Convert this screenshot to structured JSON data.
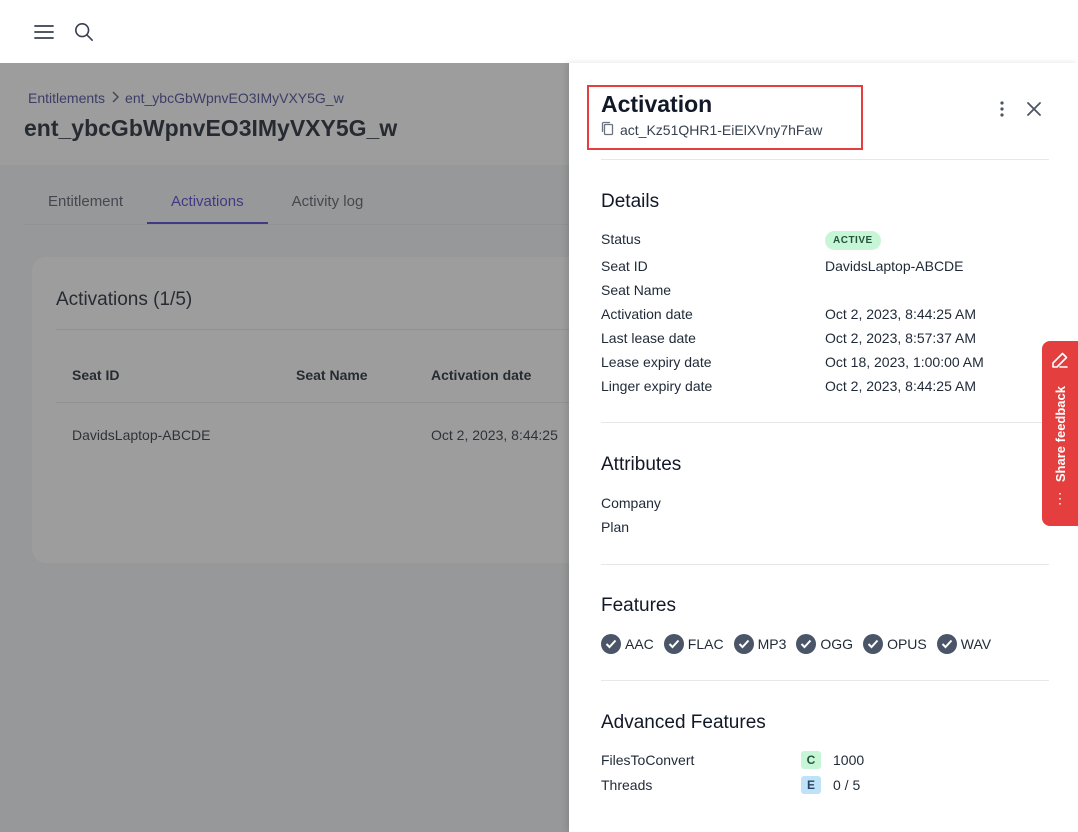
{
  "topbar": {
    "menu_icon": "hamburger-menu-icon",
    "search_icon": "search-icon"
  },
  "page": {
    "breadcrumb": [
      "Entitlements",
      "ent_ybcGbWpnvEO3IMyVXY5G_w"
    ],
    "title": "ent_ybcGbWpnvEO3IMyVXY5G_w",
    "tabs": [
      "Entitlement",
      "Activations",
      "Activity log"
    ],
    "active_tab": "Activations",
    "activations_title": "Activations (1/5)",
    "table": {
      "headers": [
        "Seat ID",
        "Seat Name",
        "Activation date"
      ],
      "rows": [
        [
          "DavidsLaptop-ABCDE",
          "",
          "Oct 2, 2023, 8:44:25"
        ]
      ]
    }
  },
  "drawer": {
    "title": "Activation",
    "id": "act_Kz51QHR1-EiElXVny7hFaw",
    "details": {
      "title": "Details",
      "status_label": "Status",
      "status_value": "ACTIVE",
      "rows": [
        {
          "label": "Seat ID",
          "value": "DavidsLaptop-ABCDE"
        },
        {
          "label": "Seat Name",
          "value": ""
        },
        {
          "label": "Activation date",
          "value": "Oct 2, 2023, 8:44:25 AM"
        },
        {
          "label": "Last lease date",
          "value": "Oct 2, 2023, 8:57:37 AM"
        },
        {
          "label": "Lease expiry date",
          "value": "Oct 18, 2023, 1:00:00 AM"
        },
        {
          "label": "Linger expiry date",
          "value": "Oct 2, 2023, 8:44:25 AM"
        }
      ]
    },
    "attributes": {
      "title": "Attributes",
      "rows": [
        "Company",
        "Plan"
      ]
    },
    "features": {
      "title": "Features",
      "items": [
        "AAC",
        "FLAC",
        "MP3",
        "OGG",
        "OPUS",
        "WAV"
      ]
    },
    "advanced": {
      "title": "Advanced Features",
      "rows": [
        {
          "label": "FilesToConvert",
          "tag": "C",
          "value": "1000"
        },
        {
          "label": "Threads",
          "tag": "E",
          "value": "0 / 5"
        }
      ]
    }
  },
  "feedback": {
    "label": "Share feedback"
  },
  "colors": {
    "accent": "#4338ca",
    "highlight_box": "#e53e3e",
    "active_badge": "#c6f6d5",
    "tag_c": "#c6f6d5",
    "tag_e": "#bee3f8"
  }
}
